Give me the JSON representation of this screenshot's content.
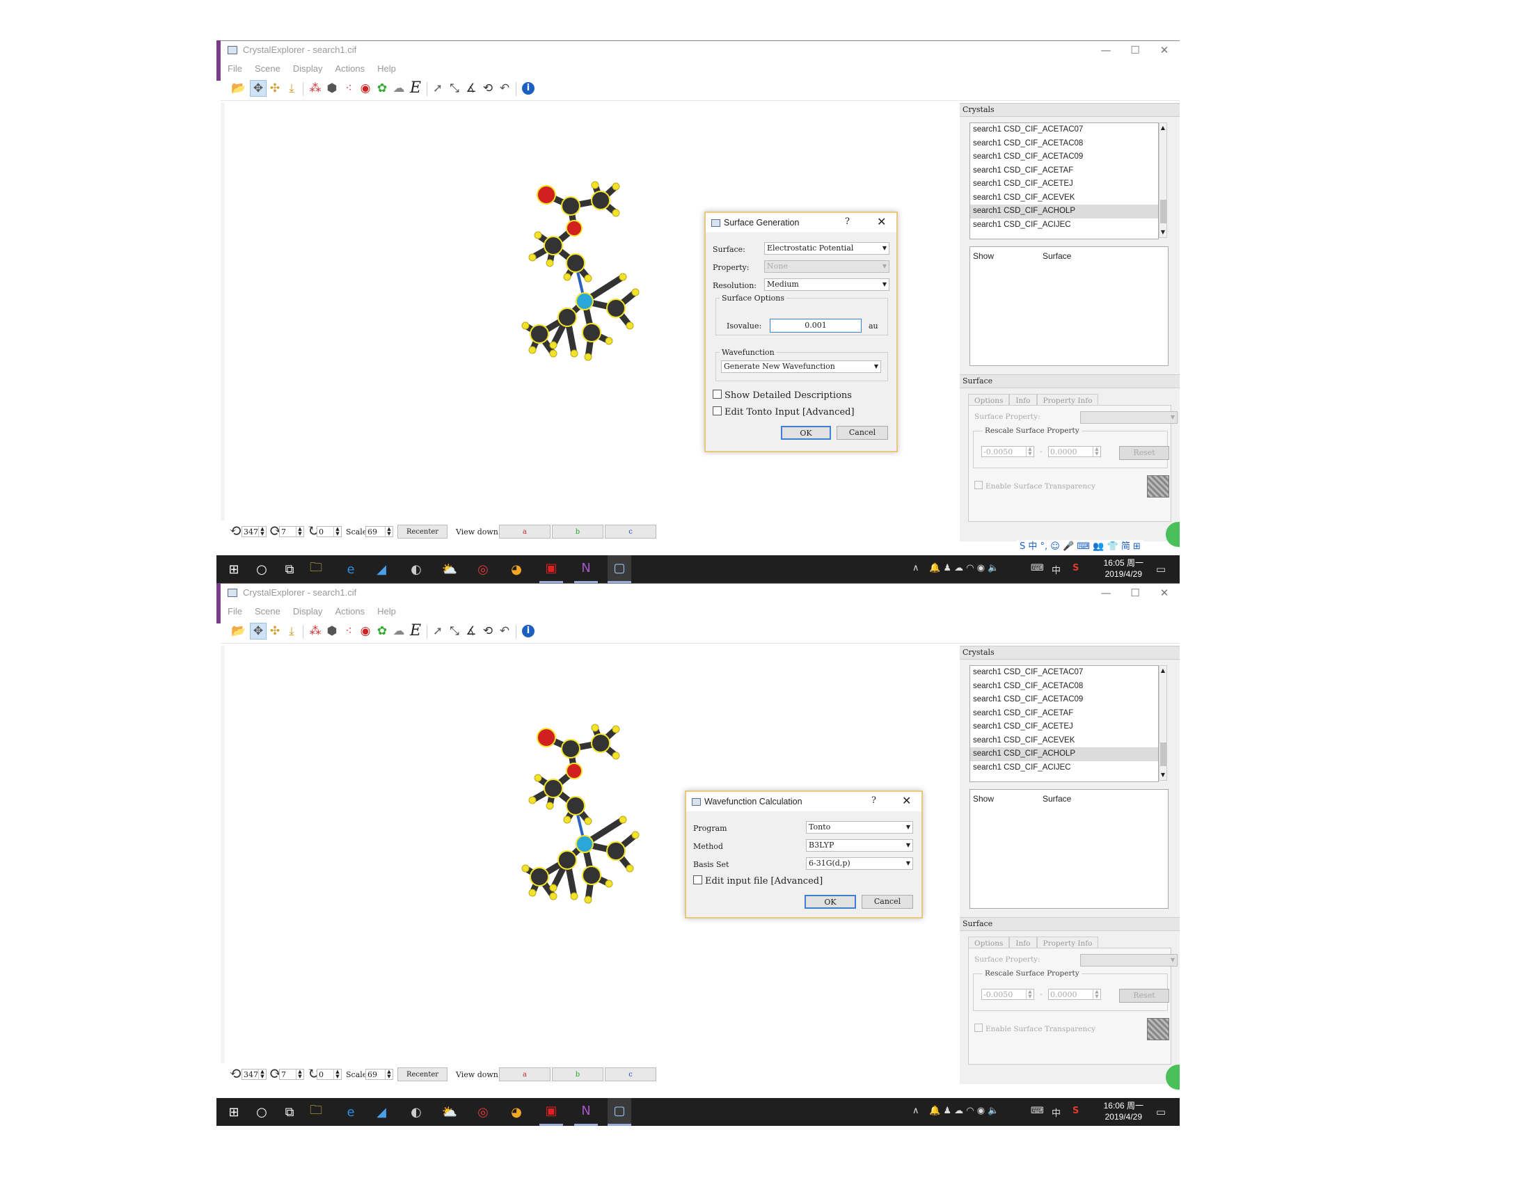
{
  "window": {
    "title": "CrystalExplorer - search1.cif",
    "minimize": "—",
    "maximize": "☐",
    "close": "✕"
  },
  "menu": [
    "File",
    "Scene",
    "Display",
    "Actions",
    "Help"
  ],
  "toolbar_icons": [
    "open-folder-icon",
    "rotate-icon",
    "translate-icon",
    "scale-icon",
    "molecule-icon",
    "cell-icon",
    "fragment-icon",
    "target-icon",
    "surface-icon",
    "cloud-icon",
    "energy-icon",
    "pointer-icon",
    "measure-distance-icon",
    "measure-angle-icon",
    "measure-torsion-icon",
    "undo-icon",
    "info-icon"
  ],
  "toolbar_energy_label": "E",
  "bottom": {
    "rot_x": "347",
    "rot_y": "7",
    "rot_z": "0",
    "scale_label": "Scale:",
    "scale_value": "69",
    "recenter": "Recenter",
    "view_down": "View down:",
    "axis_a": "a",
    "axis_b": "b",
    "axis_c": "c",
    "axis_colors": {
      "a": "#cc2222",
      "b": "#22aa22",
      "c": "#2244cc"
    }
  },
  "crystals": {
    "title": "Crystals",
    "items": [
      "search1 CSD_CIF_ACETAC07",
      "search1 CSD_CIF_ACETAC08",
      "search1 CSD_CIF_ACETAC09",
      "search1 CSD_CIF_ACETAF",
      "search1 CSD_CIF_ACETEJ",
      "search1 CSD_CIF_ACEVEK",
      "search1 CSD_CIF_ACHOLP",
      "search1 CSD_CIF_ACIJEC"
    ],
    "selected_index": 6
  },
  "surface_table": {
    "col_show": "Show",
    "col_surface": "Surface"
  },
  "surface_panel": {
    "title": "Surface",
    "tabs": [
      "Options",
      "Info",
      "Property Info"
    ],
    "surface_property_label": "Surface Property:",
    "rescale_label": "Rescale Surface Property",
    "min_value": "-0.0050",
    "max_value": "0.0000",
    "dash": "-",
    "reset": "Reset",
    "transparency": "Enable Surface Transparency"
  },
  "taskbar": {
    "shot1_time": "16:05 周一",
    "shot2_time": "16:06 周一",
    "date": "2019/4/29",
    "ime": "中",
    "ime_toolbar": "S 中 °, ☺ 🎤 ⌨ 👥 👕 简 ⊞"
  },
  "surface_dialog": {
    "title": "Surface Generation",
    "help": "?",
    "close": "✕",
    "surface_label": "Surface:",
    "surface_value": "Electrostatic Potential",
    "property_label": "Property:",
    "property_value": "None",
    "resolution_label": "Resolution:",
    "resolution_value": "Medium",
    "options_group": "Surface Options",
    "isovalue_label": "Isovalue:",
    "isovalue": "0.001",
    "isovalue_unit": "au",
    "wavefunction_group": "Wavefunction",
    "wavefunction_value": "Generate New Wavefunction",
    "show_detailed": "Show Detailed Descriptions",
    "edit_tonto": "Edit Tonto Input [Advanced]",
    "ok": "OK",
    "cancel": "Cancel"
  },
  "wavefunction_dialog": {
    "title": "Wavefunction Calculation",
    "help": "?",
    "close": "✕",
    "program_label": "Program",
    "program_value": "Tonto",
    "method_label": "Method",
    "method_value": "B3LYP",
    "basis_label": "Basis Set",
    "basis_value": "6-31G(d,p)",
    "edit_input": "Edit input file [Advanced]",
    "ok": "OK",
    "cancel": "Cancel"
  }
}
